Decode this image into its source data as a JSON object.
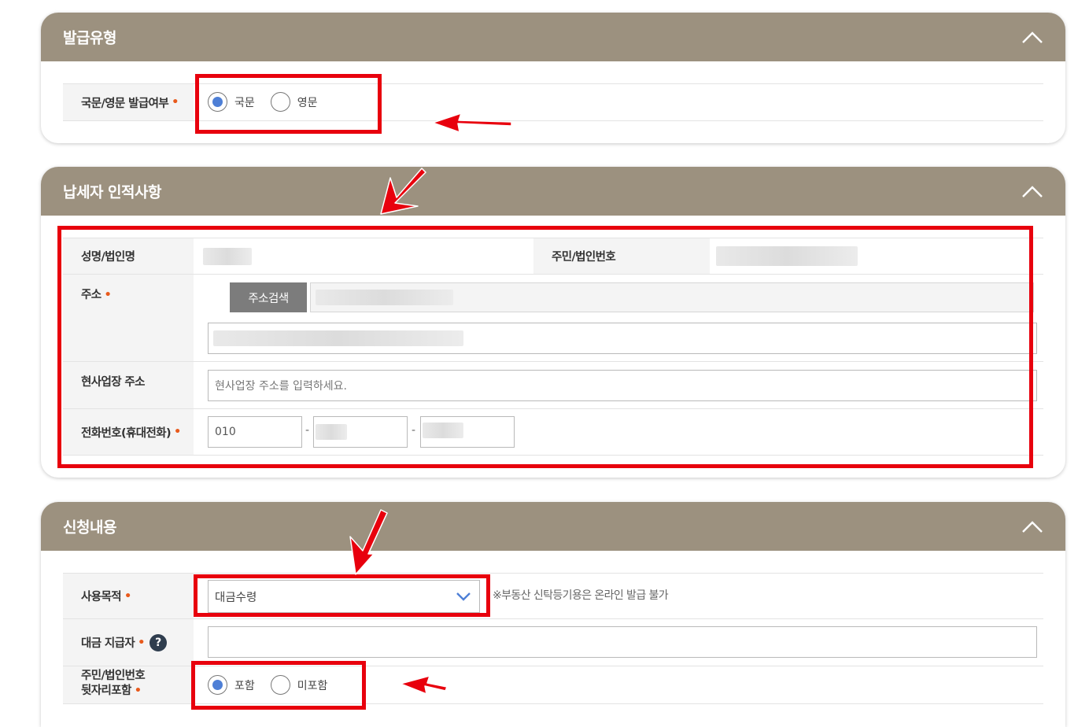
{
  "sections": {
    "issue_type": {
      "title": "발급유형",
      "label": "국문/영문 발급여부",
      "options": [
        "국문",
        "영문"
      ],
      "selected": "국문"
    },
    "taxpayer": {
      "title": "납세자 인적사항",
      "name_label": "성명/법인명",
      "id_label": "주민/법인번호",
      "address_label": "주소",
      "address_search_button": "주소검색",
      "workplace_label": "현사업장 주소",
      "workplace_placeholder": "현사업장 주소를 입력하세요.",
      "phone_label": "전화번호(휴대전화)",
      "phone_first": "010",
      "phone_separator": "-"
    },
    "application": {
      "title": "신청내용",
      "purpose_label": "사용목적",
      "purpose_selected": "대금수령",
      "purpose_note": "※부동산 신탁등기용은 온라인 발급 불가",
      "payer_label": "대금 지급자",
      "help_symbol": "?",
      "include_label_line1": "주민/법인번호",
      "include_label_line2": "뒷자리포함",
      "include_options": [
        "포함",
        "미포함"
      ],
      "include_selected": "포함"
    }
  },
  "colors": {
    "header_bg": "#9c917f",
    "required_dot": "#e85a1c",
    "radio_selected": "#4e7fd6",
    "annotation_red": "#e8000d",
    "search_button": "#7c7c7c",
    "help_icon": "#2f3d4e"
  },
  "icons": {
    "collapse": "chevron-up-icon",
    "select": "chevron-down-icon",
    "help": "question-circle-icon"
  }
}
